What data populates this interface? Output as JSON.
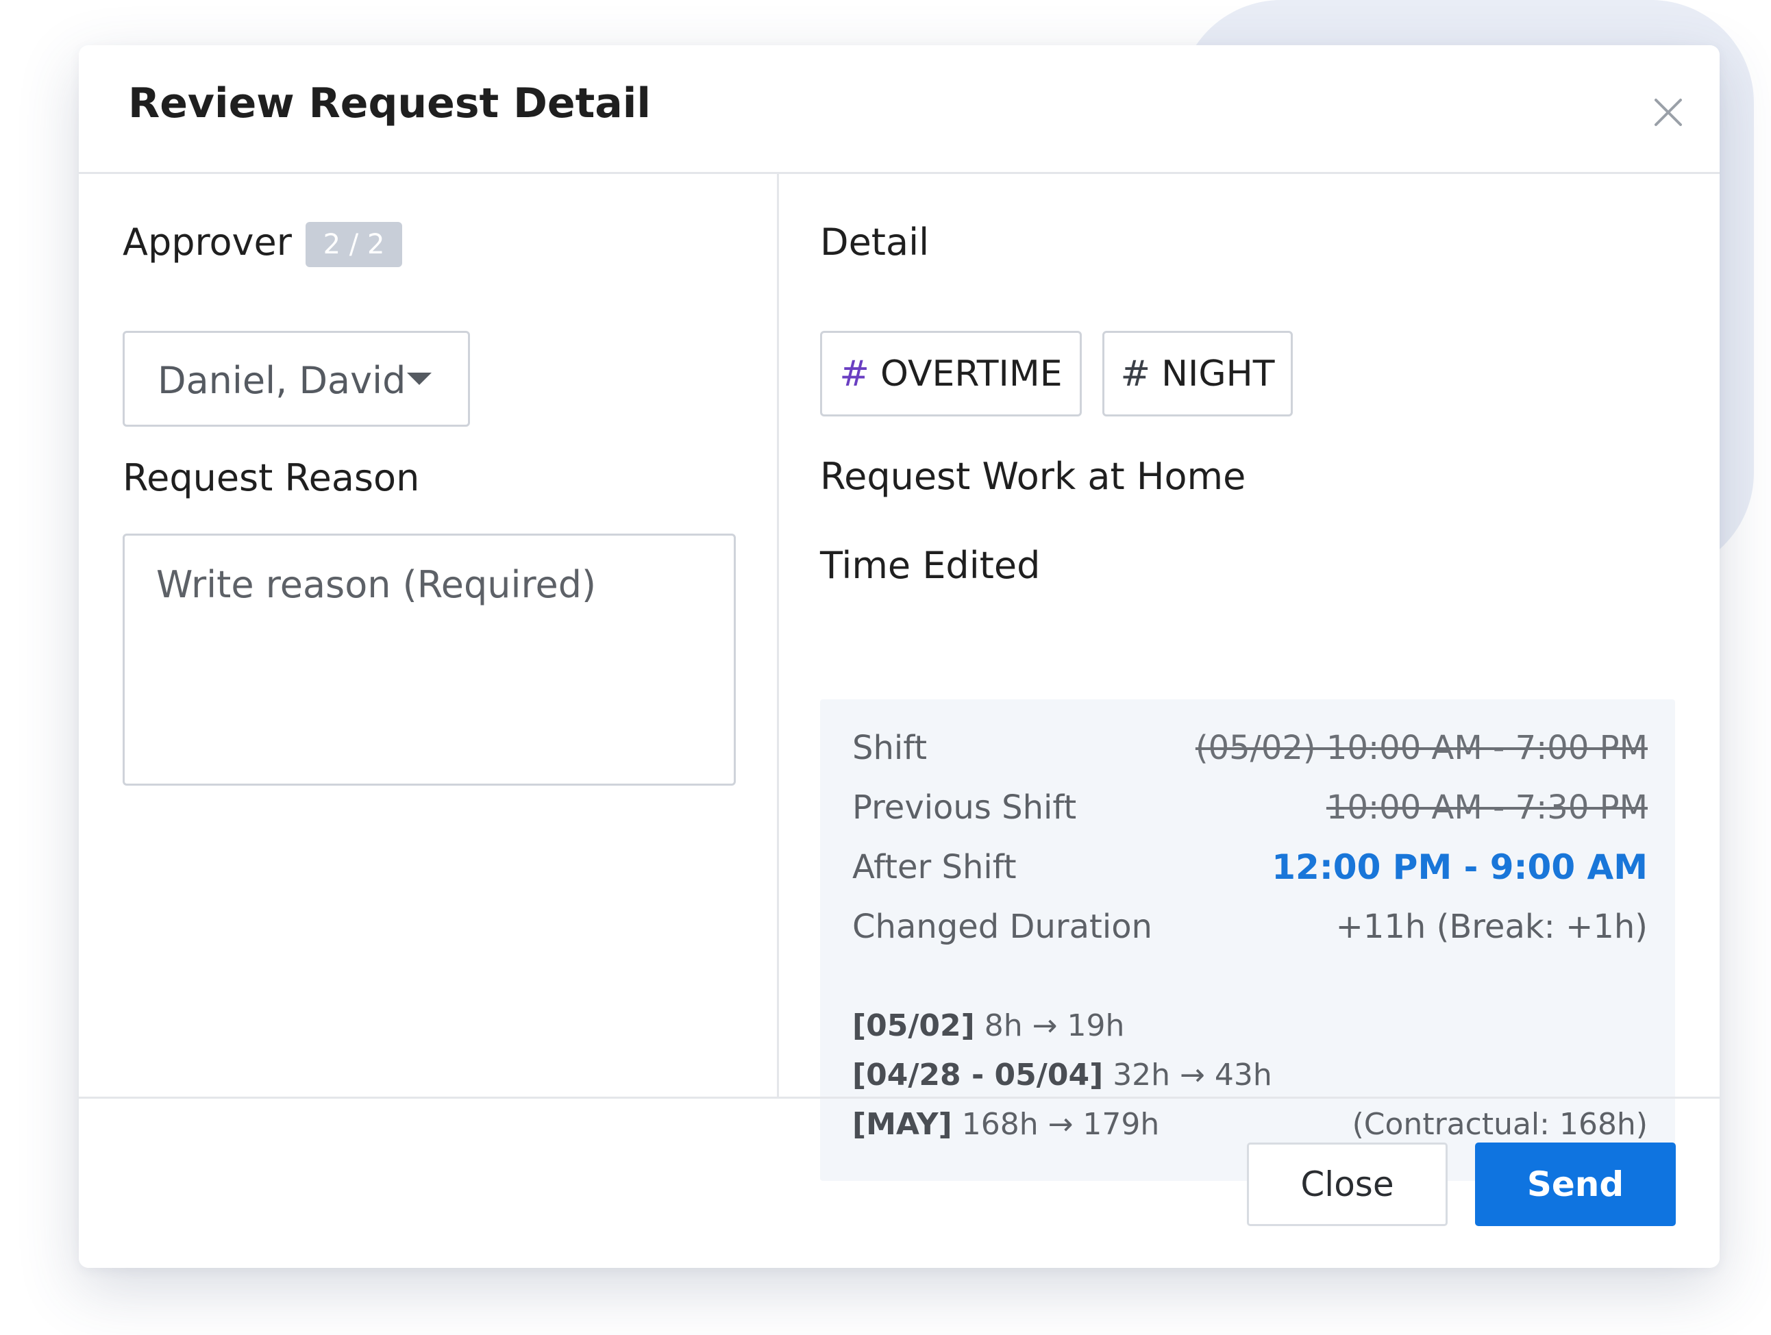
{
  "modal": {
    "title": "Review Request Detail"
  },
  "approver": {
    "label": "Approver",
    "badge": "2 / 2",
    "selected": "Daniel, David"
  },
  "reason": {
    "label": "Request Reason",
    "placeholder": "Write reason (Required)"
  },
  "detail": {
    "label": "Detail",
    "tags": [
      {
        "hash": "#",
        "text": "OVERTIME",
        "hash_color": "#6a3fc2"
      },
      {
        "hash": "#",
        "text": "NIGHT",
        "hash_color": "#3b4048"
      }
    ],
    "request_type": "Request Work at Home",
    "time_edited_label": "Time Edited"
  },
  "time_panel": {
    "rows": [
      {
        "label": "Shift",
        "value": "(05/02) 10:00 AM - 7:00 PM"
      },
      {
        "label": "Previous Shift",
        "value": "10:00 AM - 7:30 PM"
      },
      {
        "label": "After Shift",
        "value": "12:00 PM - 9:00 AM"
      },
      {
        "label": "Changed Duration",
        "value": "+11h (Break: +1h)"
      }
    ],
    "stats": [
      {
        "key": "[05/02]",
        "value": "8h → 19h",
        "note": ""
      },
      {
        "key": "[04/28 - 05/04]",
        "value": "32h → 43h",
        "note": ""
      },
      {
        "key": "[MAY]",
        "value": "168h → 179h",
        "note": "(Contractual: 168h)"
      }
    ]
  },
  "footer": {
    "close_label": "Close",
    "send_label": "Send"
  },
  "colors": {
    "accent": "#0f74e0",
    "after_shift": "#1976d9",
    "panel_bg": "#f3f6fa"
  },
  "icons": {
    "close": "close-icon",
    "dropdown": "caret-down-icon"
  }
}
